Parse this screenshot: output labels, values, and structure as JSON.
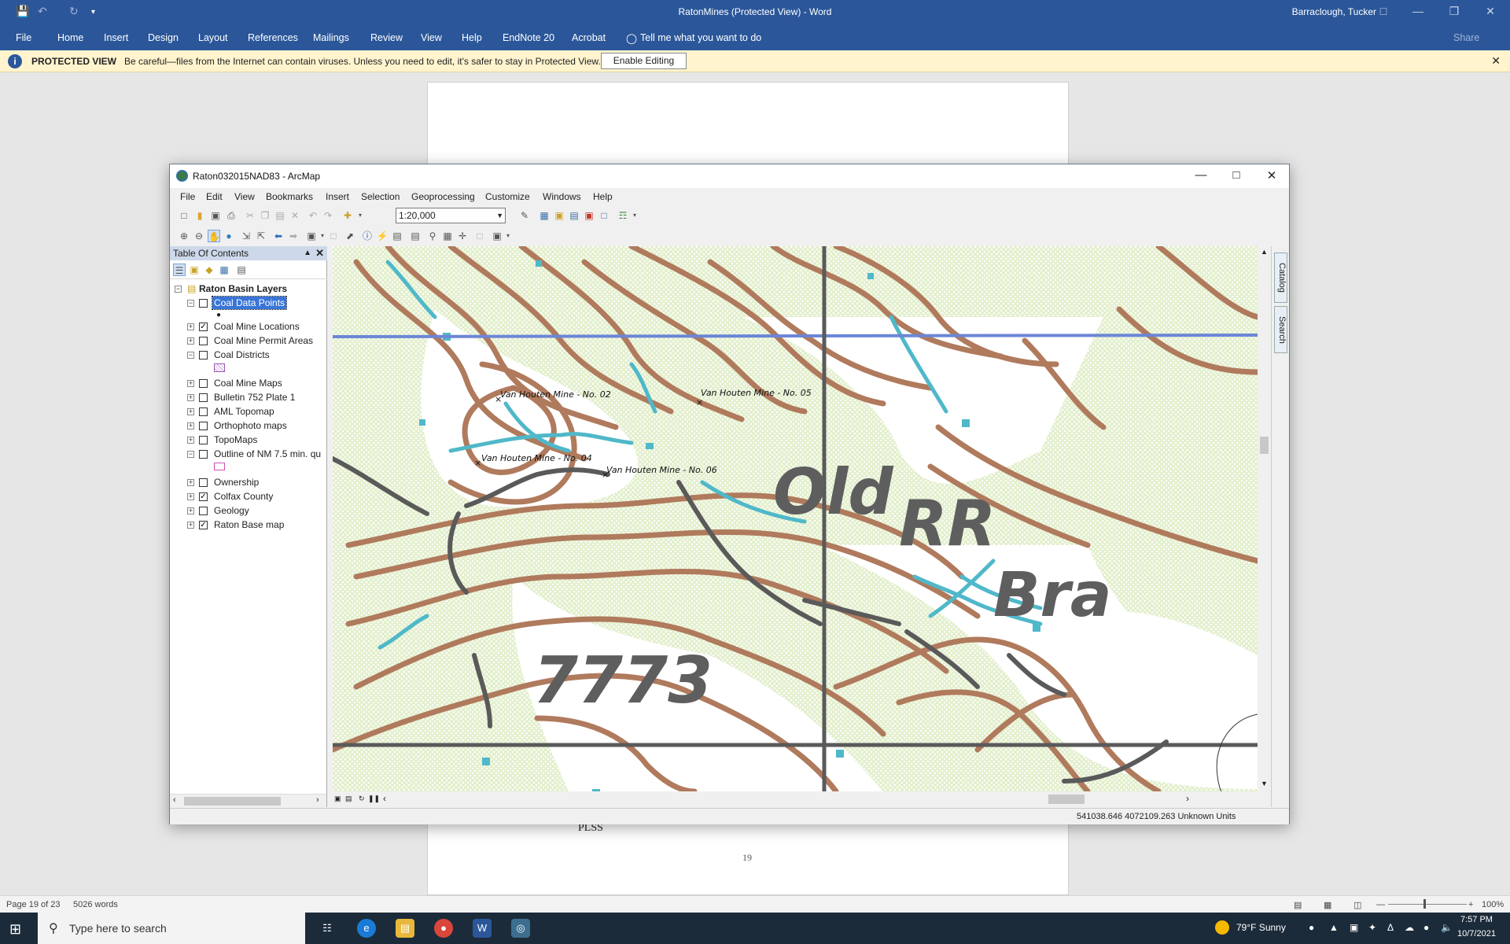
{
  "word": {
    "title": "RatonMines (Protected View)  -  Word",
    "user": "Barraclough, Tucker",
    "ribbon_tabs": [
      "File",
      "Home",
      "Insert",
      "Design",
      "Layout",
      "References",
      "Mailings",
      "Review",
      "View",
      "Help",
      "EndNote 20",
      "Acrobat"
    ],
    "tell_me": "Tell me what you want to do",
    "share": "Share",
    "protected": {
      "label": "PROTECTED VIEW",
      "message": "Be careful—files from the Internet can contain viruses. Unless you need to edit, it's safer to stay in Protected View.",
      "enable_button": "Enable Editing"
    },
    "doc": {
      "plss": "PLSS",
      "page_number": "19"
    },
    "status": {
      "page": "Page 19 of 23",
      "words": "5026 words",
      "zoom": "100%"
    }
  },
  "arcmap": {
    "title": "Raton032015NAD83 - ArcMap",
    "menu": [
      "File",
      "Edit",
      "View",
      "Bookmarks",
      "Insert",
      "Selection",
      "Geoprocessing",
      "Customize",
      "Windows",
      "Help"
    ],
    "scale": "1:20,000",
    "toc": {
      "header": "Table Of Contents",
      "root": "Raton Basin Layers",
      "layers": [
        {
          "name": "Coal Data Points",
          "checked": false,
          "expanded": true,
          "selected": true
        },
        {
          "name": "Coal Mine Locations",
          "checked": true,
          "expanded": false
        },
        {
          "name": "Coal Mine Permit Areas",
          "checked": false,
          "expanded": false
        },
        {
          "name": "Coal Districts",
          "checked": false,
          "expanded": true
        },
        {
          "name": "Coal Mine Maps",
          "checked": false,
          "expanded": false
        },
        {
          "name": "Bulletin 752 Plate 1",
          "checked": false,
          "expanded": false
        },
        {
          "name": "AML Topomap",
          "checked": false,
          "expanded": false
        },
        {
          "name": "Orthophoto maps",
          "checked": false,
          "expanded": false
        },
        {
          "name": "TopoMaps",
          "checked": false,
          "expanded": false
        },
        {
          "name": "Outline of NM 7.5 min. qu",
          "checked": false,
          "expanded": true
        },
        {
          "name": "Ownership",
          "checked": false,
          "expanded": false
        },
        {
          "name": "Colfax County",
          "checked": true,
          "expanded": false
        },
        {
          "name": "Geology",
          "checked": false,
          "expanded": false
        },
        {
          "name": "Raton Base map",
          "checked": true,
          "expanded": false
        }
      ]
    },
    "map_labels": {
      "mine_02": "Van Houten Mine - No. 02",
      "mine_05": "Van Houten Mine - No. 05",
      "mine_04": "Van Houten Mine - No. 04",
      "mine_06": "Van Houten Mine - No. 06",
      "old": "Old",
      "rr": "RR",
      "bra": "Bra",
      "elev": "7773"
    },
    "side_tabs": [
      "Catalog",
      "Search"
    ],
    "status_coords": "541038.646  4072109.263 Unknown Units"
  },
  "taskbar": {
    "search_placeholder": "Type here to search",
    "weather": "79°F  Sunny",
    "time": "7:57 PM",
    "date": "10/7/2021"
  },
  "colors": {
    "word_blue": "#2b579a",
    "contour": "#b07a5d",
    "water": "#4fb8c9",
    "veg": "#dcebc4",
    "grid_line": "#6b86d6"
  }
}
